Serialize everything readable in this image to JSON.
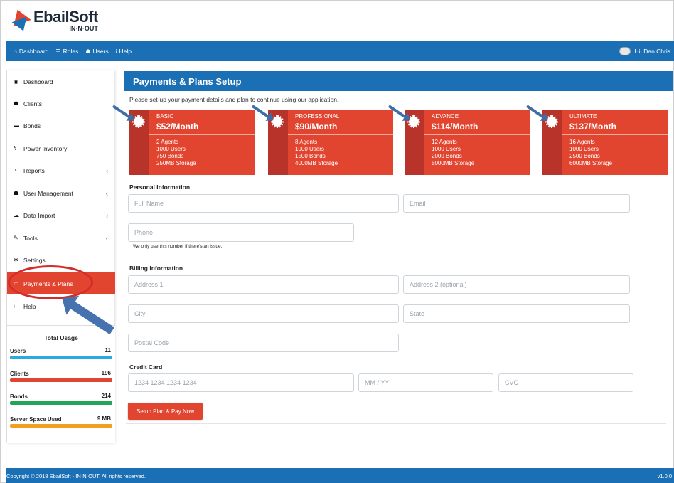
{
  "brand": {
    "name": "EbailSoft",
    "tagline": "IN·N·OUT"
  },
  "topnav": {
    "items": [
      {
        "icon": "home-icon",
        "label": "Dashboard"
      },
      {
        "icon": "list-icon",
        "label": "Roles"
      },
      {
        "icon": "users-icon",
        "label": "Users"
      },
      {
        "icon": "info-icon",
        "label": "Help"
      }
    ],
    "user_greeting": "Hi, Dan Chris"
  },
  "sidebar": {
    "items": [
      {
        "label": "Dashboard",
        "icon": "dashboard-icon",
        "glyph": "◉",
        "chevron": ""
      },
      {
        "label": "Clients",
        "icon": "users-icon",
        "glyph": "☗",
        "chevron": ""
      },
      {
        "label": "Bonds",
        "icon": "folder-icon",
        "glyph": "▬",
        "chevron": ""
      },
      {
        "label": "Power Inventory",
        "icon": "bolt-icon",
        "glyph": "ϟ",
        "chevron": ""
      },
      {
        "label": "Reports",
        "icon": "chart-icon",
        "glyph": "◔",
        "chevron": "‹"
      },
      {
        "label": "User Management",
        "icon": "users-icon",
        "glyph": "☗",
        "chevron": "‹"
      },
      {
        "label": "Data Import",
        "icon": "cloud-upload-icon",
        "glyph": "☁",
        "chevron": "‹"
      },
      {
        "label": "Tools",
        "icon": "wrench-icon",
        "glyph": "✎",
        "chevron": "‹"
      },
      {
        "label": "Settings",
        "icon": "gear-icon",
        "glyph": "✲",
        "chevron": ""
      },
      {
        "label": "Payments & Plans",
        "icon": "credit-card-icon",
        "glyph": "▭",
        "chevron": "",
        "active": true
      },
      {
        "label": "Help",
        "icon": "info-icon",
        "glyph": "i",
        "chevron": ""
      }
    ],
    "usage": {
      "title": "Total Usage",
      "rows": [
        {
          "label": "Users",
          "value": "11",
          "color": "#29abe2"
        },
        {
          "label": "Clients",
          "value": "196",
          "color": "#e2452f"
        },
        {
          "label": "Bonds",
          "value": "214",
          "color": "#21a558"
        },
        {
          "label": "Server Space Used",
          "value": "9 MB",
          "color": "#f0a020"
        }
      ]
    }
  },
  "main": {
    "title": "Payments & Plans Setup",
    "intro": "Please set-up your payment details and plan to continue using our application.",
    "plans": [
      {
        "name": "BASIC",
        "price": "$52/Month",
        "features": [
          "2 Agents",
          "1000 Users",
          "750 Bonds",
          "250MB Storage"
        ]
      },
      {
        "name": "PROFESSIONAL",
        "price": "$90/Month",
        "features": [
          "8 Agents",
          "1000 Users",
          "1500 Bonds",
          "4000MB Storage"
        ]
      },
      {
        "name": "ADVANCE",
        "price": "$114/Month",
        "features": [
          "12 Agents",
          "1000 Users",
          "2000 Bonds",
          "5000MB Storage"
        ]
      },
      {
        "name": "ULTIMATE",
        "price": "$137/Month",
        "features": [
          "16 Agents",
          "1000 Users",
          "2500 Bonds",
          "6000MB Storage"
        ]
      }
    ],
    "personal": {
      "title": "Personal Information",
      "full_name_placeholder": "Full Name",
      "email_placeholder": "Email",
      "phone_placeholder": "Phone",
      "phone_hint": "We only use this number if there's an issue."
    },
    "billing": {
      "title": "Billing Information",
      "address1_placeholder": "Address 1",
      "address2_placeholder": "Address 2 (optional)",
      "city_placeholder": "City",
      "state_placeholder": "State",
      "postal_placeholder": "Postal Code"
    },
    "card": {
      "title": "Credit Card",
      "number_placeholder": "1234 1234 1234 1234",
      "expiry_placeholder": "MM / YY",
      "cvc_placeholder": "CVC"
    },
    "submit_label": "Setup Plan & Pay Now"
  },
  "footer": {
    "copyright": "Copyright © 2018 EbailSoft - IN·N·OUT. All rights reserved.",
    "version": "v1.0.0"
  },
  "colors": {
    "primary": "#1a6fb5",
    "accent": "#e2452f"
  }
}
